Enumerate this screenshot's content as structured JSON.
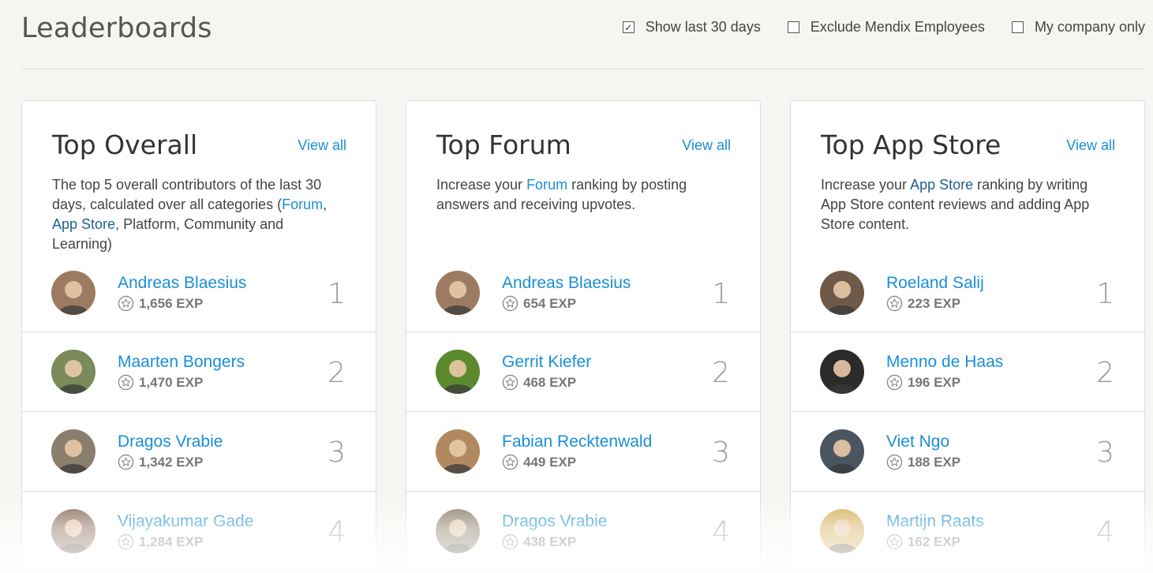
{
  "page": {
    "title": "Leaderboards"
  },
  "filters": [
    {
      "label": "Show last 30 days",
      "checked": true
    },
    {
      "label": "Exclude Mendix Employees",
      "checked": false
    },
    {
      "label": "My company only",
      "checked": false
    }
  ],
  "cards": [
    {
      "title": "Top Overall",
      "view_all": "View all",
      "desc": {
        "part1": "The top 5 overall contributors of the last 30 days, calculated over all categories (",
        "link1": "Forum",
        "part2": ",",
        "link2": "App Store",
        "part3": ", Platform, Community and Learning)"
      },
      "rows": [
        {
          "name": "Andreas Blaesius",
          "exp": "1,656 EXP",
          "rank": "1",
          "avatar_color": "#9c7b62"
        },
        {
          "name": "Maarten Bongers",
          "exp": "1,470 EXP",
          "rank": "2",
          "avatar_color": "#7a8a5a"
        },
        {
          "name": "Dragos Vrabie",
          "exp": "1,342 EXP",
          "rank": "3",
          "avatar_color": "#8a7f6c"
        },
        {
          "name": "Vijayakumar Gade",
          "exp": "1,284 EXP",
          "rank": "4",
          "avatar_color": "#8b6c5c"
        }
      ]
    },
    {
      "title": "Top Forum",
      "view_all": "View all",
      "desc": {
        "part1": "Increase your ",
        "link1": "Forum",
        "part2": " ranking by posting answers and receiving upvotes."
      },
      "rows": [
        {
          "name": "Andreas Blaesius",
          "exp": "654 EXP",
          "rank": "1",
          "avatar_color": "#9c7b62"
        },
        {
          "name": "Gerrit Kiefer",
          "exp": "468 EXP",
          "rank": "2",
          "avatar_color": "#5b8a2e"
        },
        {
          "name": "Fabian Recktenwald",
          "exp": "449 EXP",
          "rank": "3",
          "avatar_color": "#b08a5e"
        },
        {
          "name": "Dragos Vrabie",
          "exp": "438 EXP",
          "rank": "4",
          "avatar_color": "#8a7f6c"
        }
      ]
    },
    {
      "title": "Top App Store",
      "view_all": "View all",
      "desc": {
        "part1": "Increase your ",
        "link1": "App Store",
        "part2": " ranking by writing App Store content reviews and adding App Store content."
      },
      "rows": [
        {
          "name": "Roeland Salij",
          "exp": "223 EXP",
          "rank": "1",
          "avatar_color": "#6f5a4a"
        },
        {
          "name": "Menno de Haas",
          "exp": "196 EXP",
          "rank": "2",
          "avatar_color": "#2b2b2b"
        },
        {
          "name": "Viet Ngo",
          "exp": "188 EXP",
          "rank": "3",
          "avatar_color": "#4a5560"
        },
        {
          "name": "Martijn Raats",
          "exp": "162 EXP",
          "rank": "4",
          "avatar_color": "#d7b15a"
        }
      ]
    }
  ]
}
